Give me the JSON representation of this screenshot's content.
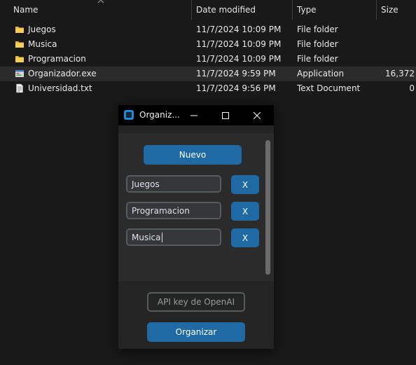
{
  "explorer": {
    "columns": {
      "name": "Name",
      "date": "Date modified",
      "type": "Type",
      "size": "Size"
    },
    "rows": [
      {
        "name": "Juegos",
        "date": "11/7/2024 10:09 PM",
        "type": "File folder",
        "size": "",
        "icon": "folder-icon"
      },
      {
        "name": "Musica",
        "date": "11/7/2024 10:09 PM",
        "type": "File folder",
        "size": "",
        "icon": "folder-icon"
      },
      {
        "name": "Programacion",
        "date": "11/7/2024 10:09 PM",
        "type": "File folder",
        "size": "",
        "icon": "folder-icon"
      },
      {
        "name": "Organizador.exe",
        "date": "11/7/2024 9:59 PM",
        "type": "Application",
        "size": "16,372",
        "icon": "application-icon",
        "selected": true
      },
      {
        "name": "Universidad.txt",
        "date": "11/7/2024 9:56 PM",
        "type": "Text Document",
        "size": "0",
        "icon": "text-file-icon"
      }
    ]
  },
  "app": {
    "title": "Organiz...",
    "new_button": "Nuevo",
    "entries": [
      {
        "value": "Juegos",
        "remove_label": "X"
      },
      {
        "value": "Programacion",
        "remove_label": "X"
      },
      {
        "value": "Musica",
        "remove_label": "X"
      }
    ],
    "api_key_button": "API key de OpenAI",
    "organize_button": "Organizar"
  },
  "colors": {
    "accent": "#1f6aa5",
    "folder": "#e8b93a",
    "window_bg": "#242424",
    "explorer_bg": "#191919"
  }
}
